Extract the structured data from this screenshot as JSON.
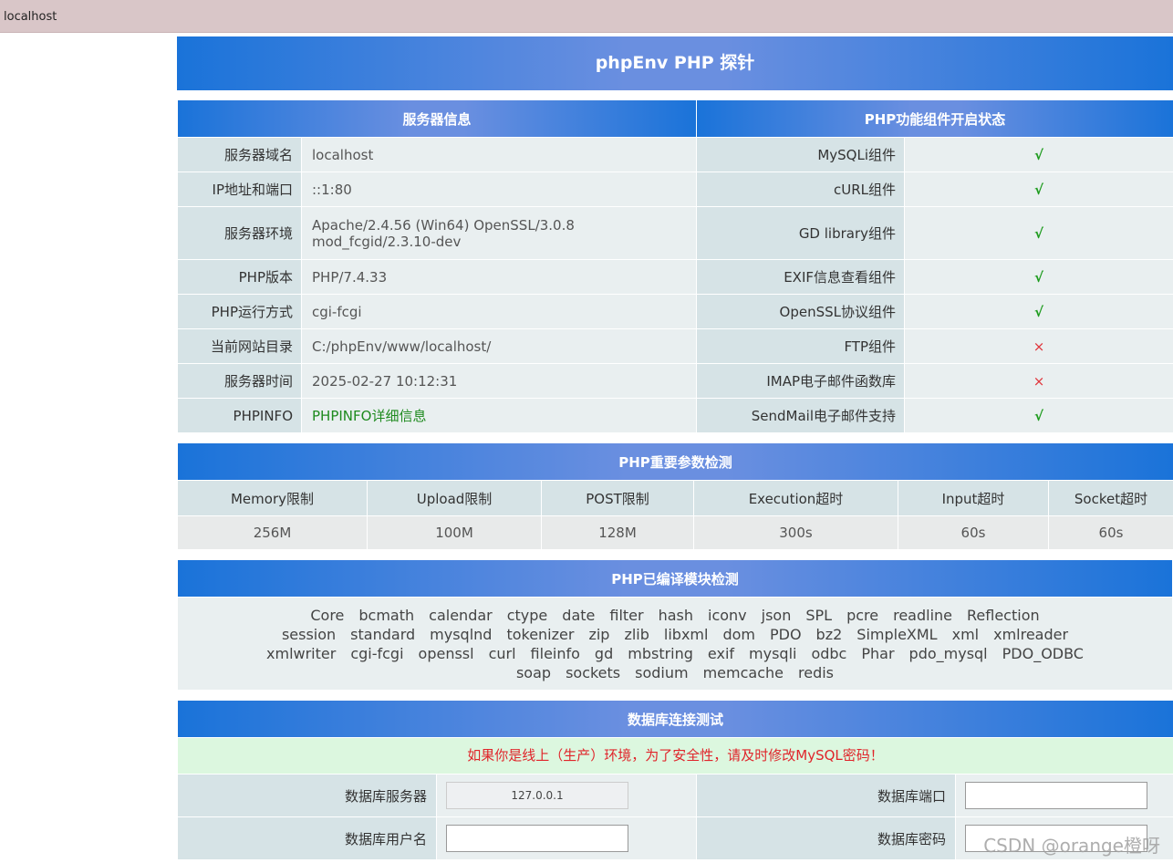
{
  "tab": {
    "title": "localhost"
  },
  "page": {
    "title": "phpEnv PHP 探针"
  },
  "server_info": {
    "header": "服务器信息",
    "rows": [
      {
        "label": "服务器域名",
        "value": "localhost"
      },
      {
        "label": "IP地址和端口",
        "value": "::1:80"
      },
      {
        "label": "服务器环境",
        "value": "Apache/2.4.56 (Win64) OpenSSL/3.0.8 mod_fcgid/2.3.10-dev"
      },
      {
        "label": "PHP版本",
        "value": "PHP/7.4.33"
      },
      {
        "label": "PHP运行方式",
        "value": "cgi-fcgi"
      },
      {
        "label": "当前网站目录",
        "value": "C:/phpEnv/www/localhost/"
      },
      {
        "label": "服务器时间",
        "value": "2025-02-27 10:12:31"
      },
      {
        "label": "PHPINFO",
        "value": "PHPINFO详细信息"
      }
    ]
  },
  "components": {
    "header": "PHP功能组件开启状态",
    "rows": [
      {
        "label": "MySQLi组件",
        "status": "√"
      },
      {
        "label": "cURL组件",
        "status": "√"
      },
      {
        "label": "GD library组件",
        "status": "√"
      },
      {
        "label": "EXIF信息查看组件",
        "status": "√"
      },
      {
        "label": "OpenSSL协议组件",
        "status": "√"
      },
      {
        "label": "FTP组件",
        "status": "×"
      },
      {
        "label": "IMAP电子邮件函数库",
        "status": "×"
      },
      {
        "label": "SendMail电子邮件支持",
        "status": "√"
      }
    ]
  },
  "params": {
    "header": "PHP重要参数检测",
    "labels": [
      "Memory限制",
      "Upload限制",
      "POST限制",
      "Execution超时",
      "Input超时",
      "Socket超时"
    ],
    "values": [
      "256M",
      "100M",
      "128M",
      "300s",
      "60s",
      "60s"
    ]
  },
  "modules": {
    "header": "PHP已编译模块检测",
    "lines": [
      [
        "Core",
        "bcmath",
        "calendar",
        "ctype",
        "date",
        "filter",
        "hash",
        "iconv",
        "json",
        "SPL",
        "pcre",
        "readline",
        "Reflection"
      ],
      [
        "session",
        "standard",
        "mysqlnd",
        "tokenizer",
        "zip",
        "zlib",
        "libxml",
        "dom",
        "PDO",
        "bz2",
        "SimpleXML",
        "xml",
        "xmlreader"
      ],
      [
        "xmlwriter",
        "cgi-fcgi",
        "openssl",
        "curl",
        "fileinfo",
        "gd",
        "mbstring",
        "exif",
        "mysqli",
        "odbc",
        "Phar",
        "pdo_mysql",
        "PDO_ODBC"
      ],
      [
        "soap",
        "sockets",
        "sodium",
        "memcache",
        "redis"
      ]
    ]
  },
  "db": {
    "header": "数据库连接测试",
    "warning": "如果你是线上（生产）环境，为了安全性，请及时修改MySQL密码！",
    "server_label": "数据库服务器",
    "server_value": "127.0.0.1",
    "port_label": "数据库端口",
    "port_value": "",
    "user_label": "数据库用户名",
    "user_value": "",
    "password_label": "数据库密码",
    "password_value": ""
  },
  "watermark": "CSDN @orange橙呀",
  "colors": {
    "header_blue": "#1a73d9",
    "ok_green": "#1d9b1d",
    "error_red": "#e0343a"
  }
}
